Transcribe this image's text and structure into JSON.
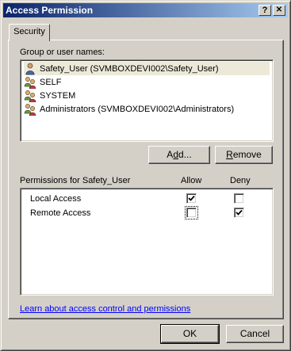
{
  "window": {
    "title": "Access Permission",
    "help_label": "?",
    "close_label": "✕"
  },
  "tabs": [
    {
      "label": "Security",
      "selected": true
    }
  ],
  "groups": {
    "label": "Group or user names:",
    "items": [
      {
        "label": "Safety_User (SVMBOXDEVI002\\Safety_User)",
        "icon": "user-icon",
        "selected": true
      },
      {
        "label": "SELF",
        "icon": "group-icon",
        "selected": false
      },
      {
        "label": "SYSTEM",
        "icon": "group-icon",
        "selected": false
      },
      {
        "label": "Administrators (SVMBOXDEVI002\\Administrators)",
        "icon": "group-icon",
        "selected": false
      }
    ]
  },
  "buttons": {
    "add": {
      "pre": "A",
      "accel": "d",
      "post": "d..."
    },
    "remove": {
      "accel": "R",
      "post": "emove"
    },
    "ok": "OK",
    "cancel": "Cancel"
  },
  "permissions": {
    "label": "Permissions for Safety_User",
    "allow_header": "Allow",
    "deny_header": "Deny",
    "rows": [
      {
        "name": "Local Access",
        "allow": true,
        "deny": false
      },
      {
        "name": "Remote Access",
        "allow": false,
        "deny": true
      }
    ]
  },
  "learn_link": "Learn about access control and permissions",
  "colors": {
    "title_start": "#0a246a",
    "title_end": "#a6caf0",
    "face": "#d4d0c8",
    "link": "#0000ff"
  }
}
